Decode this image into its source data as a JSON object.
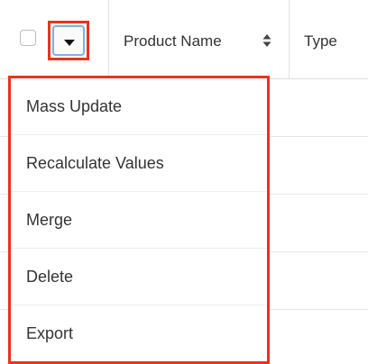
{
  "header": {
    "product_name": "Product Name",
    "type": "Type"
  },
  "actions_menu": {
    "items": [
      {
        "label": "Mass Update"
      },
      {
        "label": "Recalculate Values"
      },
      {
        "label": "Merge"
      },
      {
        "label": "Delete"
      },
      {
        "label": "Export"
      }
    ]
  },
  "colors": {
    "highlight": "#e8341c",
    "focus_ring": "#7eb0e3"
  }
}
